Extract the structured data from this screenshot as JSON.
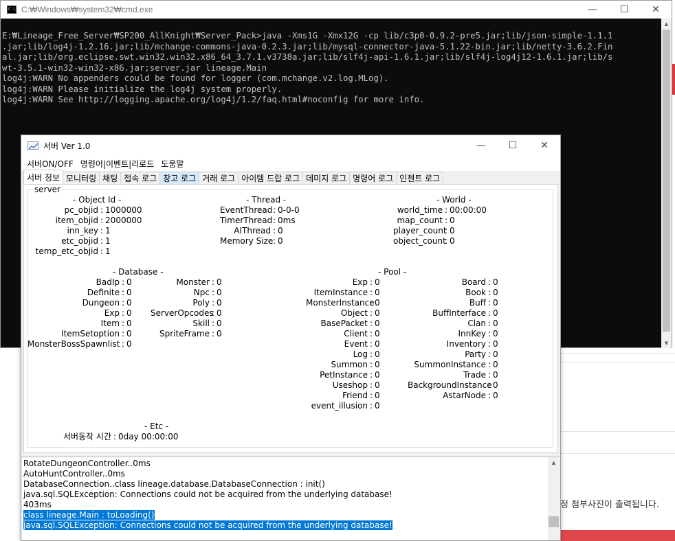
{
  "cmd": {
    "title": "C:₩Windows₩system32₩cmd.exe",
    "lines": [
      "E:₩Lineage_Free_Server₩SP200_AllKnight₩Server_Pack>java -Xms1G -Xmx12G -cp lib/c3p0-0.9.2-pre5.jar;lib/json-simple-1.1.1",
      ".jar;lib/log4j-1.2.16.jar;lib/mchange-commons-java-0.2.3.jar;lib/mysql-connector-java-5.1.22-bin.jar;lib/netty-3.6.2.Fin",
      "al.jar;lib/org.eclipse.swt.win32.win32.x86_64_3.7.1.v3738a.jar;lib/slf4j-api-1.6.1.jar;lib/slf4j-log4j12-1.6.1.jar;lib/s",
      "wt-3.5.1-win32-win32-x86.jar;server.jar lineage.Main",
      "log4j:WARN No appenders could be found for logger (com.mchange.v2.log.MLog).",
      "log4j:WARN Please initialize the log4j system properly.",
      "log4j:WARN See http://logging.apache.org/log4j/1.2/faq.html#noconfig for more info."
    ]
  },
  "window_buttons": {
    "minimize": "—",
    "maximize": "☐",
    "close": "✕"
  },
  "server": {
    "title": "서버  Ver 1.0",
    "menu": [
      "서버ON/OFF",
      "명령어|이벤트|리로드",
      "도움말"
    ],
    "tabs": [
      "서버 정보",
      "모니터링",
      "채팅",
      "접속 로그",
      "창고 로그",
      "거래 로그",
      "아이템 드랍 로그",
      "데미지 로그",
      "명령어 로그",
      "인첸트 로그"
    ],
    "group_label": "server",
    "object_id": {
      "title": "- Object Id -",
      "items": [
        {
          "key": "pc_objid",
          "value": "1000000"
        },
        {
          "key": "item_objid",
          "value": "2000000"
        },
        {
          "key": "inn_key",
          "value": "1"
        },
        {
          "key": "etc_objid",
          "value": "1"
        },
        {
          "key": "temp_etc_objid",
          "value": "1"
        }
      ]
    },
    "thread": {
      "title": "- Thread -",
      "items": [
        {
          "key": "EventThread",
          "value": "0-0-0"
        },
        {
          "key": "TimerThread",
          "value": "0ms"
        },
        {
          "key": "AIThread",
          "value": "0"
        },
        {
          "key": "Memory Size",
          "value": "0"
        }
      ]
    },
    "world": {
      "title": "- World -",
      "items": [
        {
          "key": "world_time",
          "value": "00:00:00"
        },
        {
          "key": "map_count",
          "value": "0"
        },
        {
          "key": "player_count",
          "value": "0"
        },
        {
          "key": "object_count",
          "value": "0"
        }
      ]
    },
    "database": {
      "title": "- Database -",
      "col1": [
        {
          "key": "BadIp",
          "value": "0"
        },
        {
          "key": "Definite",
          "value": "0"
        },
        {
          "key": "Dungeon",
          "value": "0"
        },
        {
          "key": "Exp",
          "value": "0"
        },
        {
          "key": "Item",
          "value": "0"
        },
        {
          "key": "ItemSetoption",
          "value": "0"
        },
        {
          "key": "MonsterBossSpawnlist",
          "value": "0"
        }
      ],
      "col2": [
        {
          "key": "Monster",
          "value": "0"
        },
        {
          "key": "Npc",
          "value": "0"
        },
        {
          "key": "Poly",
          "value": "0"
        },
        {
          "key": "ServerOpcodes",
          "value": "0"
        },
        {
          "key": "Skill",
          "value": "0"
        },
        {
          "key": "SpriteFrame",
          "value": "0"
        }
      ]
    },
    "pool": {
      "title": "- Pool -",
      "col1": [
        {
          "key": "Exp",
          "value": "0"
        },
        {
          "key": "ItemInstance",
          "value": "0"
        },
        {
          "key": "MonsterInstance",
          "value": "0"
        },
        {
          "key": "Object",
          "value": "0"
        },
        {
          "key": "BasePacket",
          "value": "0"
        },
        {
          "key": "Client",
          "value": "0"
        },
        {
          "key": "Event",
          "value": "0"
        },
        {
          "key": "Log",
          "value": "0"
        },
        {
          "key": "Summon",
          "value": "0"
        },
        {
          "key": "PetInstance",
          "value": "0"
        },
        {
          "key": "Useshop",
          "value": "0"
        },
        {
          "key": "Friend",
          "value": "0"
        },
        {
          "key": "event_illusion",
          "value": "0"
        }
      ],
      "col2": [
        {
          "key": "Board",
          "value": "0"
        },
        {
          "key": "Book",
          "value": "0"
        },
        {
          "key": "Buff",
          "value": "0"
        },
        {
          "key": "BuffInterface",
          "value": "0"
        },
        {
          "key": "Clan",
          "value": "0"
        },
        {
          "key": "InnKey",
          "value": "0"
        },
        {
          "key": "Inventory",
          "value": "0"
        },
        {
          "key": "Party",
          "value": "0"
        },
        {
          "key": "SummonInstance",
          "value": "0"
        },
        {
          "key": "Trade",
          "value": "0"
        },
        {
          "key": "BackgroundInstance",
          "value": "0"
        },
        {
          "key": "AstarNode",
          "value": "0"
        }
      ]
    },
    "etc": {
      "title": "- Etc -",
      "items": [
        {
          "key": "서버동작 시간",
          "value": "0day 00:00:00"
        }
      ]
    },
    "log_lines": [
      {
        "text": "RotateDungeonController..0ms",
        "selected": false
      },
      {
        "text": "AutoHuntController..0ms",
        "selected": false
      },
      {
        "text": "DatabaseConnection..class lineage.database.DatabaseConnection : init()",
        "selected": false
      },
      {
        "text": "java.sql.SQLException: Connections could not be acquired from the underlying database!",
        "selected": false
      },
      {
        "text": "403ms",
        "selected": false
      },
      {
        "text": "class lineage.Main : toLoading() ",
        "selected": true
      },
      {
        "text": "java.sql.SQLException: Connections could not be acquired from the underlying database!",
        "selected": true
      }
    ]
  },
  "background": {
    "partial_text": "정 첨부사진이 출력됩니다."
  },
  "colors": {
    "console_bg": "#0c0c0c",
    "console_text": "#c0c0c0",
    "selection": "#0078d7",
    "accent_red": "#e0454c"
  }
}
